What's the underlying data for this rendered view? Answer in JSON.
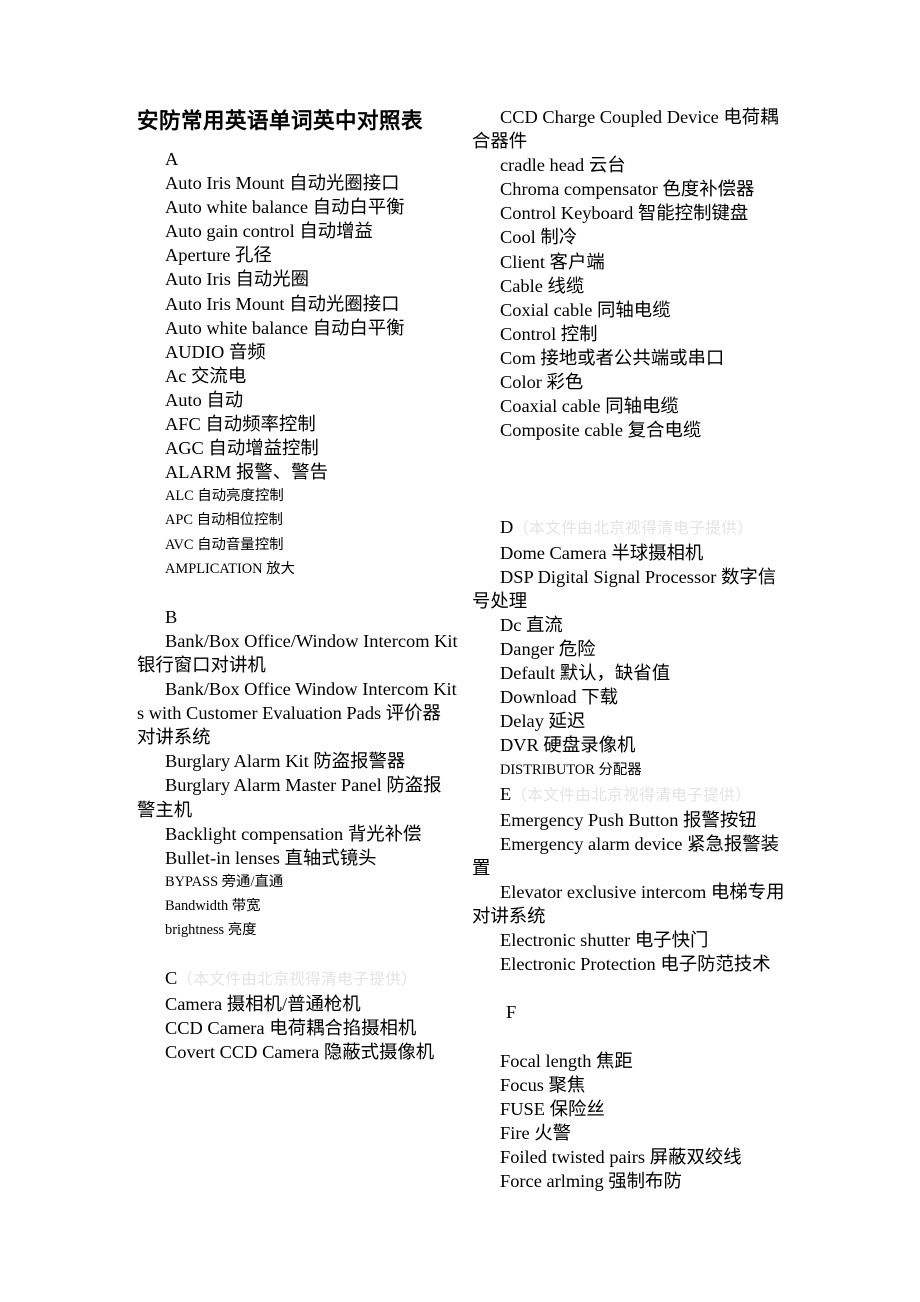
{
  "document": {
    "title": "安防常用英语单词英中对照表",
    "watermark": "（本文件由北京视得清电子提供）"
  },
  "left_column": {
    "sections": [
      {
        "letter": "A",
        "entries": [
          "Auto Iris Mount 自动光圈接口",
          "Auto white balance 自动白平衡",
          "Auto gain control 自动增益",
          "Aperture 孔径",
          "Auto Iris                自动光圈",
          "Auto Iris Mount 自动光圈接口",
          "Auto white balance 自动白平衡",
          "AUDIO                音频",
          "Ac                        交流电",
          "Auto                    自动",
          "AFC   自动频率控制",
          "AGC   自动增益控制",
          "ALARM 报警、警告"
        ],
        "entries_small": [
          "ALC      自动亮度控制",
          "APC      自动相位控制",
          "AVC      自动音量控制",
          "AMPLICATION   放大"
        ]
      },
      {
        "letter": "B",
        "entries": [
          "Bank/Box Office/Window Intercom Kit       银行窗口对讲机",
          "Bank/Box Office Window Intercom Kits with Customer Evaluation Pads 评价器对讲系统",
          "Burglary Alarm Kit 防盗报警器",
          "Burglary Alarm Master Panel 防盗报警主机",
          "Backlight compensation 背光补偿",
          "Bullet-in lenses   直轴式镜头"
        ],
        "entries_small": [
          "BYPASS     旁通/直通",
          "Bandwidth    带宽",
          "brightness     亮度"
        ]
      },
      {
        "letter": "C",
        "entries": [
          "Camera      摄相机/普通枪机",
          "CCD Camera        电荷耦合掐摄相机",
          "Covert CCD Camera      隐蔽式摄像机"
        ],
        "entries_small": []
      }
    ]
  },
  "right_column": {
    "sections": [
      {
        "letter": "",
        "entries": [
          "CCD Charge Coupled Device  电荷耦合器件",
          "cradle head             云台",
          "Chroma compensator 色度补偿器",
          "Control Keyboard    智能控制键盘",
          "Cool     制冷",
          "Client   客户端",
          "Cable      线缆",
          "Coxial cable    同轴电缆",
          "Control      控制",
          "Com  接地或者公共端或串口",
          "Color   彩色",
          "Coaxial cable   同轴电缆",
          "Composite cable   复合电缆"
        ],
        "entries_small": []
      },
      {
        "letter": "D",
        "entries": [
          "Dome Camera 半球摄相机",
          "DSP  Digital Signal Processor 数字信号处理",
          "Dc                    直流",
          "Danger   危险",
          "Default   默认，缺省值",
          "Download  下载",
          "Delay 延迟",
          "DVR      硬盘录像机"
        ],
        "entries_small": [
          "DISTRIBUTOR      分配器"
        ]
      },
      {
        "letter": "E",
        "entries": [
          "Emergency Push Button 报警按钮",
          "Emergency alarm device 紧急报警装置",
          "Elevator exclusive intercom    电梯专用对讲系统",
          "Electronic shutter    电子快门",
          "Electronic Protection 电子防范技术"
        ],
        "entries_small": []
      },
      {
        "letter": "F",
        "entries": [
          "Focal length    焦距",
          "Focus              聚焦",
          "FUSE              保险丝",
          "Fire    火警",
          "Foiled twisted pairs 屏蔽双绞线",
          "Force arlming 强制布防"
        ],
        "entries_small": []
      }
    ]
  }
}
